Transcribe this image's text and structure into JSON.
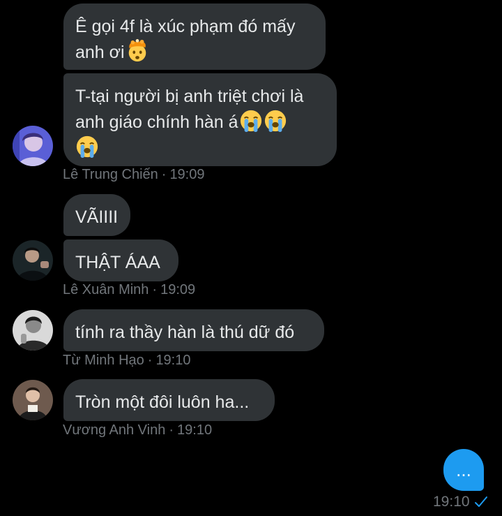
{
  "colors": {
    "background": "#000000",
    "received_bubble": "#2f3336",
    "sent_bubble": "#1d9bf0",
    "text": "#e7e9ea",
    "meta_text": "#71767b",
    "read_check": "#1d9bf0"
  },
  "messages": {
    "m1": {
      "line1": "Ê gọi 4f là xúc phạm đó mấy",
      "line2": "anh ơi",
      "emoji": "exploding-head-icon"
    },
    "m2": {
      "line1": "T-tại người bị anh triệt chơi là",
      "line2": "anh giáo chính hàn á",
      "emoji": "loudly-crying-face-icon"
    },
    "m3": {
      "text": "VÃIIII"
    },
    "m4": {
      "text": "THẬT ÁAA"
    },
    "m5": {
      "text": "tính ra thầy hàn là thú dữ đó"
    },
    "m6": {
      "text": "Tròn một đôi luôn ha..."
    }
  },
  "groups": {
    "g1": {
      "sender": "Lê Trung Chiến",
      "time": "19:09"
    },
    "g2": {
      "sender": "Lê Xuân Minh",
      "time": "19:09"
    },
    "g3": {
      "sender": "Từ Minh Hạo",
      "time": "19:10"
    },
    "g4": {
      "sender": "Vương Anh Vinh",
      "time": "19:10"
    }
  },
  "sent": {
    "text": "...",
    "time": "19:10",
    "status_icon": "read-check-icon"
  }
}
